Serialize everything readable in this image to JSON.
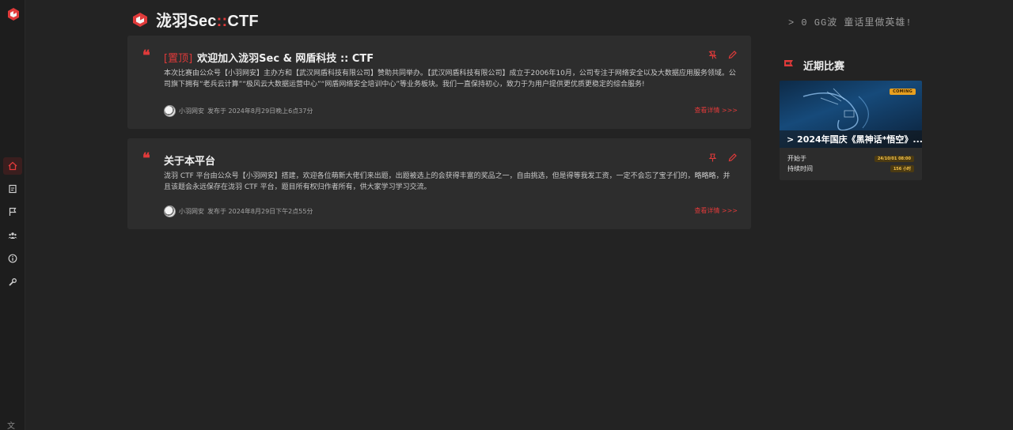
{
  "brand": {
    "name_prefix": "泷羽Sec",
    "name_sep": "::",
    "name_suffix": "CTF"
  },
  "motto": "> 0 GG波 童话里做英雄!",
  "nav": {
    "items": [
      {
        "icon": "home-icon",
        "active": true
      },
      {
        "icon": "notice-icon",
        "active": false
      },
      {
        "icon": "flag-icon",
        "active": false
      },
      {
        "icon": "team-icon",
        "active": false
      },
      {
        "icon": "info-icon",
        "active": false
      },
      {
        "icon": "wrench-icon",
        "active": false
      }
    ],
    "bottom_glyph": "文"
  },
  "announcements": [
    {
      "pin_tag": "[置顶]",
      "title": "欢迎加入泷羽Sec & 网盾科技 :: CTF",
      "body": "本次比赛由公众号【小羽网安】主办方和【武汉网盾科技有限公司】赞助共同举办。【武汉网盾科技有限公司】成立于2006年10月，公司专注于网络安全以及大数据应用服务领域。公司旗下拥有“老兵云计算”“极风云大数据运营中心”“网盾网络安全培训中心”等业务板块。我们一直保持初心，致力于为用户提供更优质更稳定的综合服务!",
      "author": "小羽网安",
      "posted": "发布于 2024年8月29日晚上6点37分",
      "detail": "查看详情 >>>"
    },
    {
      "pin_tag": "",
      "title": "关于本平台",
      "body": "泷羽 CTF 平台由公众号【小羽网安】搭建，欢迎各位萌新大佬们来出题，出题被选上的会获得丰富的奖品之一，自由挑选，但是得等我发工资，一定不会忘了宝子们的，略略略，并且该题会永远保存在泷羽 CTF 平台，题目所有权归作者所有，供大家学习学习交流。",
      "author": "小羽网安",
      "posted": "发布于 2024年8月29日下午2点55分",
      "detail": "查看详情 >>>"
    }
  ],
  "upcoming": {
    "section_title": "近期比赛",
    "competition": {
      "badge": "COMING",
      "title": "> 2024年国庆《黑神话*悟空》...",
      "start_label": "开始于",
      "start_value": "24/10/01 08:00",
      "duration_label": "持续时间",
      "duration_value": "156 小时"
    }
  },
  "colors": {
    "accent": "#e03a3a",
    "background": "#232323",
    "card": "#2d2d2d",
    "badge": "#e8a020"
  }
}
